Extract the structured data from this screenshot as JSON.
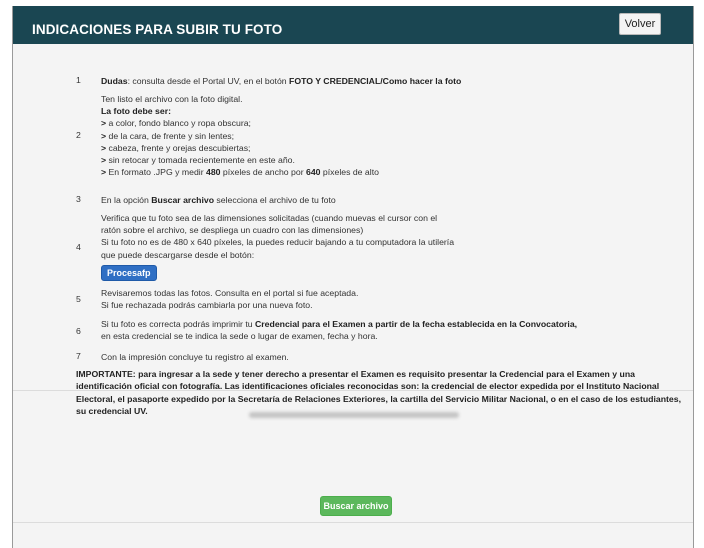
{
  "header": {
    "title": "INDICACIONES PARA SUBIR TU FOTO",
    "back_button": "Volver"
  },
  "steps": [
    {
      "num": "1",
      "lines": [
        [
          {
            "t": "Dudas",
            "b": true
          },
          {
            "t": ": consulta desde el Portal UV, en el botón "
          },
          {
            "t": "FOTO Y CREDENCIAL/Como hacer la foto",
            "b": true
          }
        ]
      ]
    },
    {
      "num": "2",
      "lines": [
        [
          {
            "t": "Ten listo el archivo con la foto digital."
          }
        ],
        [
          {
            "t": "La foto debe ser:",
            "b": true
          }
        ],
        [
          {
            "t": ">",
            "b": true
          },
          {
            "t": " a color, fondo blanco y ropa obscura;"
          }
        ],
        [
          {
            "t": ">",
            "b": true
          },
          {
            "t": " de la cara, de frente y sin lentes;"
          }
        ],
        [
          {
            "t": ">",
            "b": true
          },
          {
            "t": " cabeza, frente y orejas descubiertas;"
          }
        ],
        [
          {
            "t": ">",
            "b": true
          },
          {
            "t": " sin retocar y tomada recientemente en este año."
          }
        ],
        [
          {
            "t": ">",
            "b": true
          },
          {
            "t": " En formato .JPG y medir "
          },
          {
            "t": "480",
            "b": true
          },
          {
            "t": " píxeles de ancho por "
          },
          {
            "t": "640",
            "b": true
          },
          {
            "t": " píxeles de alto"
          }
        ]
      ]
    },
    {
      "num": "3",
      "lines": [
        [
          {
            "t": "En la opción "
          },
          {
            "t": "Buscar archivo",
            "b": true
          },
          {
            "t": " selecciona el archivo de tu foto"
          }
        ]
      ]
    },
    {
      "num": "4",
      "lines": [
        [
          {
            "t": "Verifica que tu foto sea de las dimensiones solicitadas (cuando muevas el cursor con el"
          }
        ],
        [
          {
            "t": "ratón sobre el archivo, se despliega un cuadro con las dimensiones)"
          }
        ],
        [
          {
            "t": "Si tu foto no es de 480 x 640 píxeles, la puedes reducir bajando a tu computadora la utilería"
          }
        ],
        [
          {
            "t": "que puede descargarse desde el botón:"
          }
        ]
      ],
      "button": "Procesafp"
    },
    {
      "num": "5",
      "lines": [
        [
          {
            "t": "Revisaremos todas las fotos. Consulta en el portal si fue aceptada."
          }
        ],
        [
          {
            "t": "Si fue rechazada podrás cambiarla por una nueva foto."
          }
        ]
      ]
    },
    {
      "num": "6",
      "lines": [
        [
          {
            "t": "Si tu foto es correcta podrás imprimir tu "
          },
          {
            "t": "Credencial para el Examen a partir de la fecha establecida en la Convocatoria,",
            "b": true
          }
        ],
        [
          {
            "t": "en esta credencial se te indica la sede o lugar de examen, fecha y hora."
          }
        ]
      ]
    },
    {
      "num": "7",
      "lines": [
        [
          {
            "t": "Con la impresión concluye tu registro al examen."
          }
        ]
      ]
    }
  ],
  "importante": "IMPORTANTE: para ingresar a la sede y tener derecho a presentar el Examen es requisito presentar la Credencial para el Examen y una identificación oficial con fotografía. Las identificaciones oficiales reconocidas son: la credencial de elector expedida por el Instituto Nacional Electoral, el pasaporte expedido por la Secretaría de Relaciones Exteriores, la cartilla del Servicio Militar Nacional, o en el caso de los estudiantes, su credencial UV.",
  "search_button": "Buscar archivo",
  "colors": {
    "header_bg": "#1a4652",
    "procesafp_button": "#2f6fc4",
    "buscar_button": "#5cb85c"
  }
}
